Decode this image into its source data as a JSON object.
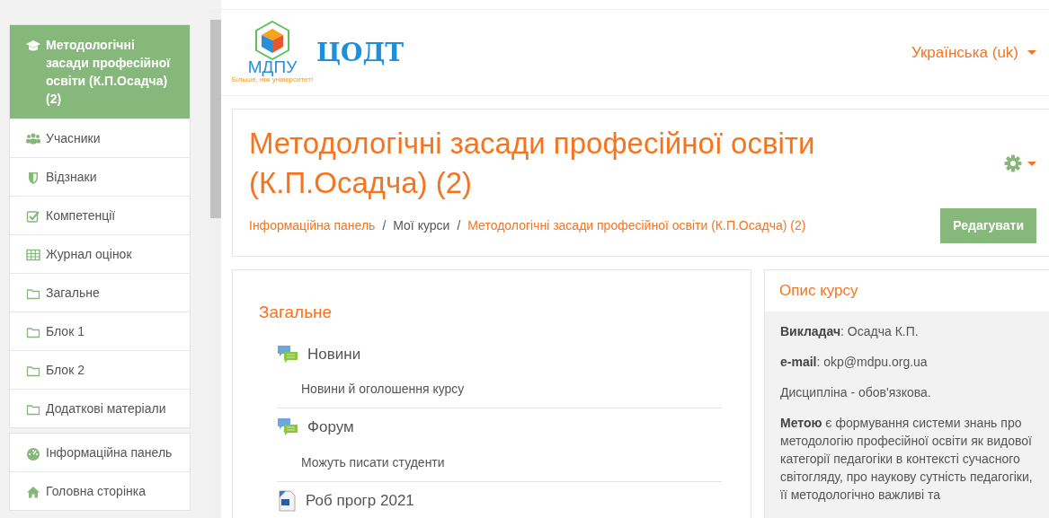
{
  "sidebar": {
    "groups": [
      {
        "items": [
          {
            "kind": "course",
            "label": "Методологічні засади професійної освіти (К.П.Осадча) (2)",
            "selected": true
          },
          {
            "kind": "participants",
            "label": "Учасники",
            "selected": false
          },
          {
            "kind": "badges",
            "label": "Відзнаки",
            "selected": false
          },
          {
            "kind": "competencies",
            "label": "Компетенції",
            "selected": false
          },
          {
            "kind": "grades",
            "label": "Журнал оцінок",
            "selected": false
          },
          {
            "kind": "folder",
            "label": "Загальне",
            "selected": false
          },
          {
            "kind": "folder",
            "label": "Блок 1",
            "selected": false
          },
          {
            "kind": "folder",
            "label": "Блок 2",
            "selected": false
          },
          {
            "kind": "folder",
            "label": "Додаткові матеріали",
            "selected": false
          }
        ]
      },
      {
        "items": [
          {
            "kind": "dashboard",
            "label": "Інформаційна панель",
            "selected": false
          },
          {
            "kind": "home",
            "label": "Головна сторінка",
            "selected": false
          }
        ]
      }
    ]
  },
  "header": {
    "logo": {
      "abbr": "МДПУ",
      "tagline": "Більше, ніж університет!",
      "site_name": "ЦОДТ"
    },
    "language": "Українська (uk)"
  },
  "page_header": {
    "title": "Методологічні засади професійної освіти (К.П.Осадча) (2)",
    "breadcrumb": [
      {
        "text": "Інформаційна панель",
        "link": true
      },
      {
        "separator": "/",
        "text": "Мої курси",
        "link": false
      },
      {
        "separator": "/",
        "text": "Методологічні засади професійної освіти (К.П.Осадча) (2)",
        "link": true
      }
    ],
    "edit_button": "Редагувати"
  },
  "section": {
    "title": "Загальне",
    "activities": [
      {
        "kind": "forum",
        "name": "Новини",
        "description": "Новини й оголошення курсу"
      },
      {
        "kind": "forum",
        "name": "Форум",
        "description": "Можуть писати студенти"
      },
      {
        "kind": "document",
        "name": "Роб прогр 2021"
      }
    ]
  },
  "course_summary": {
    "title": "Опис курсу",
    "paragraphs": [
      "**Викладач**: Осадча К.П.",
      "**e-mail**: okp@mdpu.org.ua",
      "Дисципліна - обов'язкова.",
      "**Метою** є формування системи знань про методологію професійної освіти як видової категорії педагогіки в контексті сучасного світогляду, про наукову сутність педагогіки, її методологічно важливі та"
    ]
  }
}
